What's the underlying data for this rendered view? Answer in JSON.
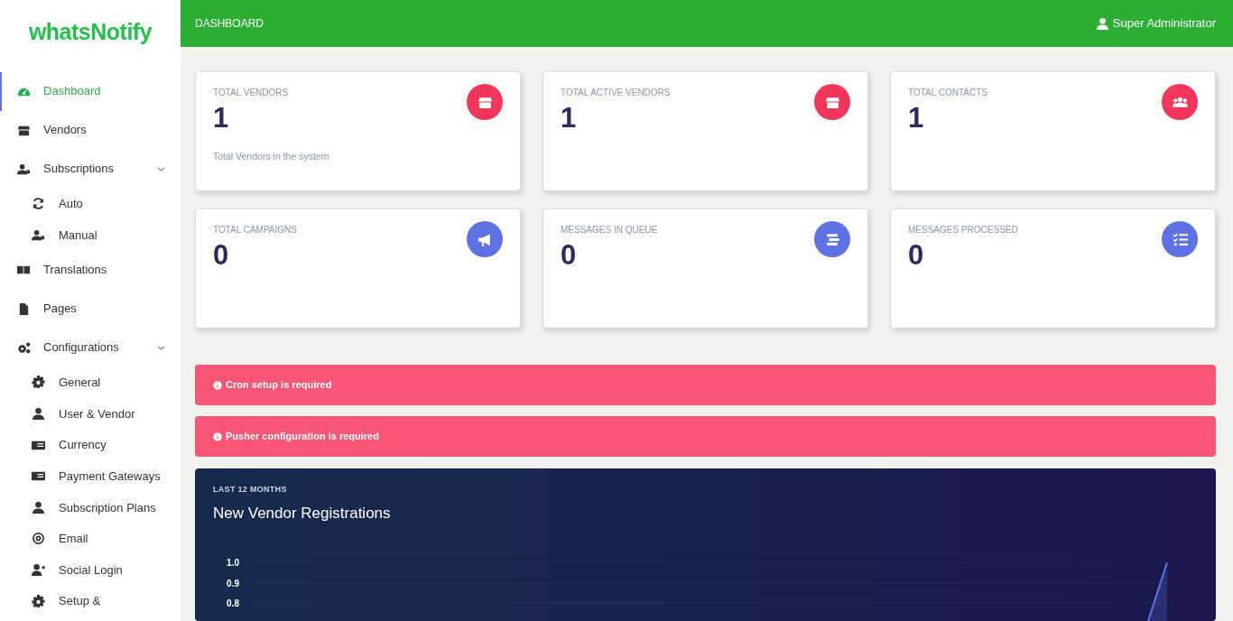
{
  "brand": {
    "part_1": "whats",
    "part_2": "Notify"
  },
  "sidebar": {
    "items": [
      {
        "label": "Dashboard",
        "kind": "gauge",
        "selected": true
      },
      {
        "label": "Vendors",
        "kind": "store",
        "selected": false
      },
      {
        "label": "Subscriptions",
        "kind": "usercard",
        "selected": false,
        "expanded": true,
        "children": [
          {
            "label": "Auto",
            "kind": "sync",
            "selected": false
          },
          {
            "label": "Manual",
            "kind": "usercard",
            "selected": false
          }
        ]
      },
      {
        "label": "Translations",
        "kind": "translate",
        "selected": false
      },
      {
        "label": "Pages",
        "kind": "file",
        "selected": false
      },
      {
        "label": "Configurations",
        "kind": "gears",
        "selected": false,
        "expanded": true,
        "children": [
          {
            "label": "General",
            "kind": "gear",
            "selected": false
          },
          {
            "label": "User & Vendor",
            "kind": "user",
            "selected": false
          },
          {
            "label": "Currency",
            "kind": "money",
            "selected": false
          },
          {
            "label": "Payment Gateways",
            "kind": "money",
            "selected": false
          },
          {
            "label": "Subscription Plans",
            "kind": "user",
            "selected": false
          },
          {
            "label": "Email",
            "kind": "at",
            "selected": false
          },
          {
            "label": "Social Login",
            "kind": "userplus",
            "selected": false
          },
          {
            "label": "Setup &",
            "kind": "gear",
            "selected": false
          }
        ]
      }
    ]
  },
  "topbar": {
    "title": "DASHBOARD",
    "user": "Super Administrator"
  },
  "stats": [
    {
      "label": "TOTAL VENDORS",
      "value": "1",
      "note": "Total Vendors in the system",
      "kind": "store",
      "color": "#f5365c"
    },
    {
      "label": "TOTAL ACTIVE VENDORS",
      "value": "1",
      "kind": "store",
      "color": "#f5365c"
    },
    {
      "label": "TOTAL CONTACTS",
      "value": "1",
      "kind": "users",
      "color": "#f5365c"
    },
    {
      "label": "TOTAL CAMPAIGNS",
      "value": "0",
      "kind": "megaphone",
      "color": "#5e72e4"
    },
    {
      "label": "MESSAGES IN QUEUE",
      "value": "0",
      "kind": "stack",
      "color": "#5e72e4"
    },
    {
      "label": "MESSAGES PROCESSED",
      "value": "0",
      "kind": "tasks",
      "color": "#5e72e4"
    }
  ],
  "alerts": [
    {
      "text": "Cron setup is required"
    },
    {
      "text": "Pusher configuration is required"
    }
  ],
  "chart_card": {
    "overline": "LAST 12 MONTHS",
    "title": "New Vendor Registrations",
    "y_axis_labels": [
      "1.0",
      "0.9",
      "0.8"
    ]
  }
}
